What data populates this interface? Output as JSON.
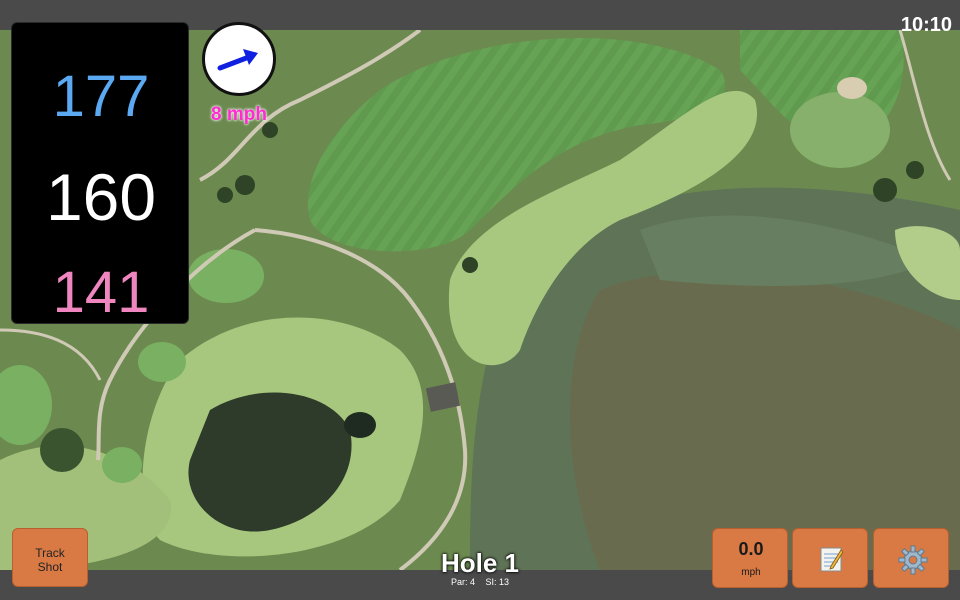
{
  "status": {
    "time": "10:10"
  },
  "distances": {
    "back": "177",
    "middle": "160",
    "front": "141"
  },
  "wind": {
    "speed": "8 mph",
    "icon": "wind-direction-arrow-icon"
  },
  "hole": {
    "title": "Hole 1",
    "par": "Par: 4",
    "si": "SI: 13"
  },
  "buttons": {
    "track_shot": {
      "line1": "Track",
      "line2": "Shot"
    },
    "speed": {
      "value": "0.0",
      "unit": "mph"
    },
    "notes": {
      "icon": "notepad-icon"
    },
    "settings": {
      "icon": "gear-icon"
    }
  },
  "colors": {
    "back_distance": "#5aa9f2",
    "middle_distance": "#ffffff",
    "front_distance": "#ef86c0",
    "wind_label": "#ff2bd0",
    "button": "#d97a45",
    "bar": "#4a4a4a"
  }
}
